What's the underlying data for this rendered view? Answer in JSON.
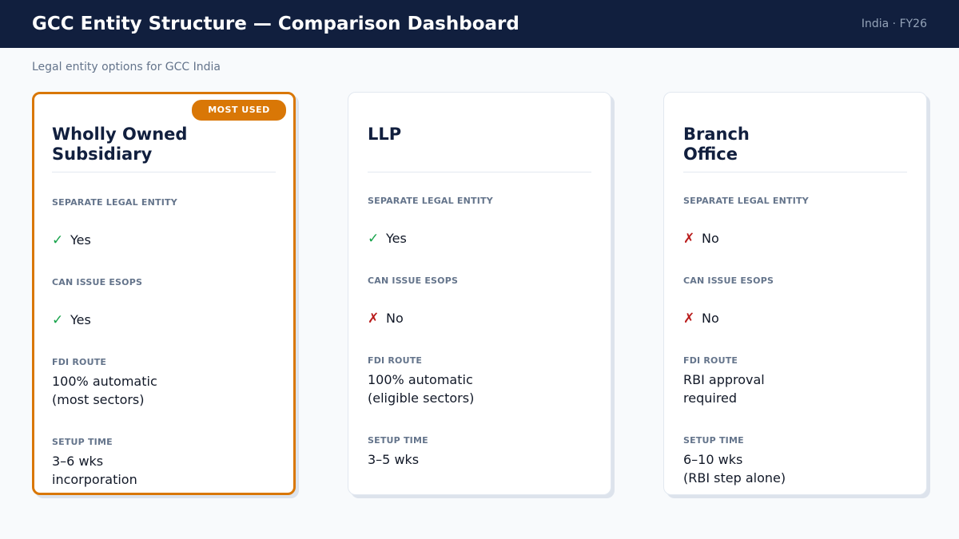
{
  "header": {
    "title": "GCC Entity Structure — Comparison Dashboard",
    "meta": "India · FY26"
  },
  "subtitle": "Legal entity options for GCC India",
  "labels": {
    "separate_legal_entity": "SEPARATE LEGAL ENTITY",
    "can_issue_esops": "CAN ISSUE ESOPS",
    "fdi_route": "FDI ROUTE",
    "setup_time": "SETUP TIME"
  },
  "colors": {
    "header_bg": "#111f3e",
    "accent": "#d97706",
    "check": "#16a34a",
    "cross": "#b91c1c"
  },
  "cards": [
    {
      "badge": "MOST USED",
      "title": "Wholly Owned\nSubsidiary",
      "separate_legal_entity": {
        "icon": "✓",
        "icon_name": "check-icon",
        "value": "Yes"
      },
      "can_issue_esops": {
        "icon": "✓",
        "icon_name": "check-icon",
        "value": "Yes"
      },
      "fdi_route": "100% automatic\n(most sectors)",
      "setup_time": "3–6 wks\nincorporation"
    },
    {
      "title": "LLP",
      "separate_legal_entity": {
        "icon": "✓",
        "icon_name": "check-icon",
        "value": "Yes"
      },
      "can_issue_esops": {
        "icon": "✗",
        "icon_name": "cross-icon",
        "value": "No"
      },
      "fdi_route": "100% automatic\n(eligible sectors)",
      "setup_time": "3–5 wks"
    },
    {
      "title": "Branch\nOffice",
      "separate_legal_entity": {
        "icon": "✗",
        "icon_name": "cross-icon",
        "value": "No"
      },
      "can_issue_esops": {
        "icon": "✗",
        "icon_name": "cross-icon",
        "value": "No"
      },
      "fdi_route": "RBI approval\nrequired",
      "setup_time": "6–10 wks\n(RBI step alone)"
    }
  ]
}
